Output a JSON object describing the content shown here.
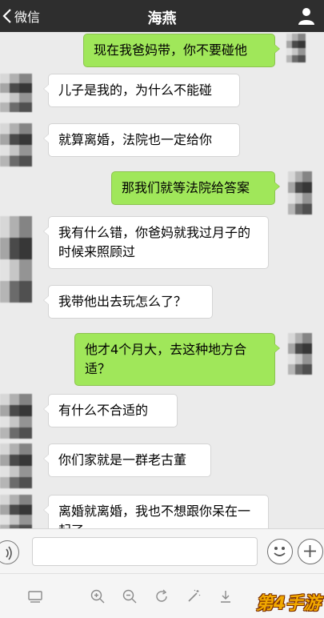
{
  "header": {
    "back_label": "微信",
    "title": "海燕"
  },
  "messages": [
    {
      "side": "right",
      "text": "现在我爸妈带，你不要碰他"
    },
    {
      "side": "left",
      "text": "儿子是我的，为什么不能碰"
    },
    {
      "side": "left",
      "text": "就算离婚，法院也一定给你"
    },
    {
      "side": "right",
      "text": "那我们就等法院给答案"
    },
    {
      "side": "left",
      "text": "我有什么错，你爸妈就我过月子的时候来照顾过"
    },
    {
      "side": "left",
      "text": "我带他出去玩怎么了？"
    },
    {
      "side": "right",
      "text": "他才4个月大，去这种地方合适？"
    },
    {
      "side": "left",
      "text": "有什么不合适的"
    },
    {
      "side": "left",
      "text": "你们家就是一群老古董"
    },
    {
      "side": "left",
      "text": "离婚就离婚，我也不想跟你呆在一起了"
    }
  ],
  "watermark": "第4手游",
  "colors": {
    "nav_bg": "#2e2e2e",
    "chat_bg": "#ebebeb",
    "sent_bubble": "#a0e75a",
    "received_bubble": "#ffffff"
  }
}
